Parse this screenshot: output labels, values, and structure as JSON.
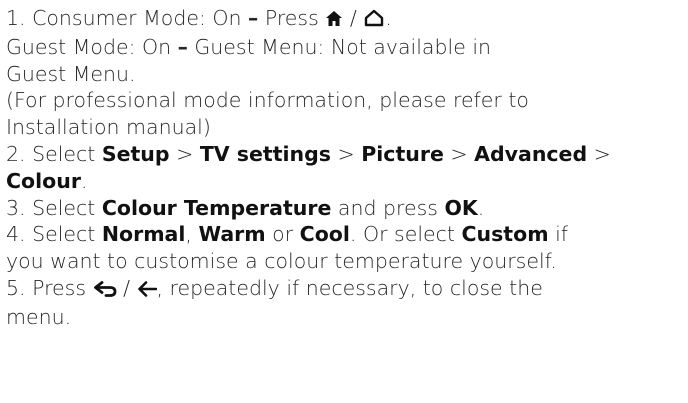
{
  "step1": {
    "line1_pre": "1. Consumer Mode: On ",
    "dash": "–",
    "line1_press": " Press ",
    "slash": " / ",
    "period": ".",
    "line2_pre": "Guest Mode: On ",
    "line2_post": " Guest Menu: Not available in",
    "line3": "Guest Menu.",
    "line4": "(For professional mode information, please refer to",
    "line5": "Installation manual)",
    "home_icon": "home-filled-icon",
    "home_outline_icon": "home-outline-icon"
  },
  "step2": {
    "prefix": "2. Select ",
    "setup": "Setup",
    "sep1": " > ",
    "tv_settings": "TV settings",
    "sep2": " > ",
    "picture": "Picture",
    "sep3": " > ",
    "advanced": "Advanced",
    "sep4": " >",
    "colour": "Colour",
    "end": "."
  },
  "step3": {
    "prefix": "3. Select ",
    "colour_temperature": "Colour Temperature",
    "mid": " and press ",
    "ok": "OK",
    "end": "."
  },
  "step4": {
    "prefix": "4. Select ",
    "normal": "Normal",
    "comma": ", ",
    "warm": "Warm",
    "or1": " or ",
    "cool": "Cool",
    "mid": ". Or select ",
    "custom": "Custom",
    "if": " if",
    "line2": "you want to customise a colour temperature yourself."
  },
  "step5": {
    "prefix": "5. Press ",
    "slash": " / ",
    "post": ", repeatedly if necessary, to close the",
    "line2": "menu.",
    "back_icon": "back-arrow-icon",
    "left_arrow_icon": "left-arrow-icon"
  }
}
